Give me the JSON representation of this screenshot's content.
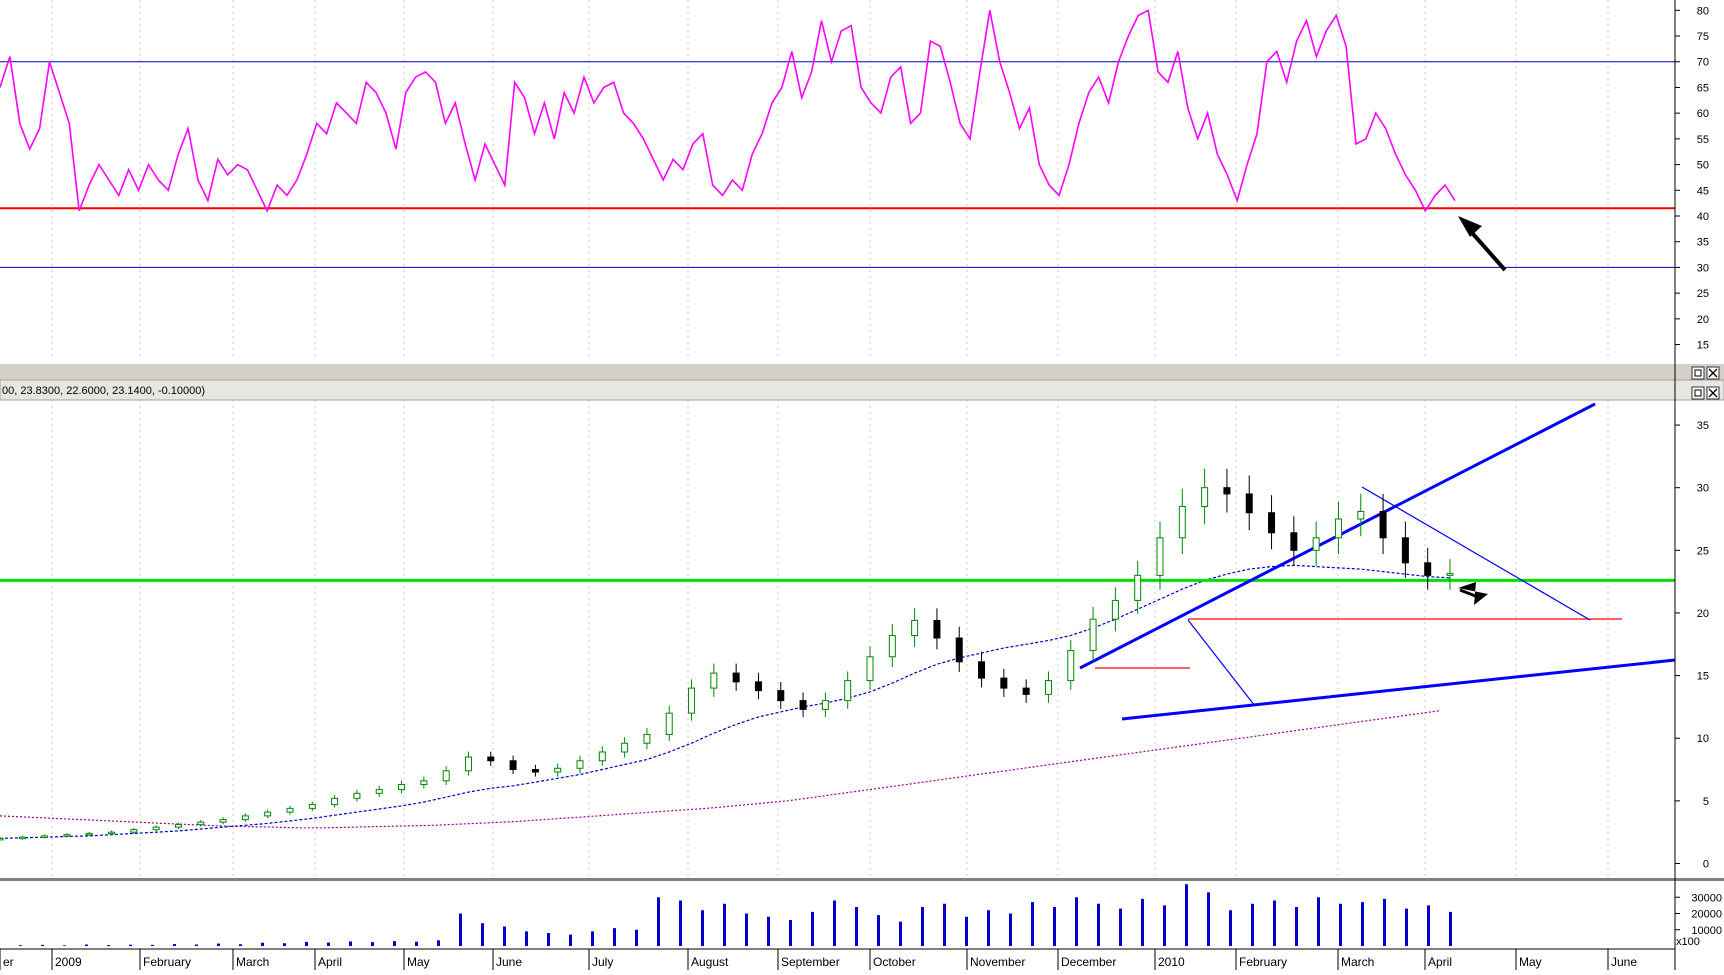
{
  "colors": {
    "rsi_line": "#ff00ff",
    "band": "#0000cc",
    "support": "#ff0000",
    "resistance": "#00dd00",
    "trend": "#0000ff",
    "ma_short": "#0000cc",
    "ma_long": "#990099",
    "bull": "#008800",
    "bear": "#000000",
    "volume": "#0000cc",
    "separator": "#d4d0c8"
  },
  "header": {
    "price_readout": "00, 23.8300, 22.6000, 23.1400, -0.10000)"
  },
  "window_controls": {
    "maximize": "□",
    "close": "✕"
  },
  "volume_multiplier": "x100",
  "chart_data": [
    {
      "panel": "rsi",
      "type": "line",
      "ylim": [
        12,
        82
      ],
      "yticks": [
        15,
        20,
        25,
        30,
        35,
        40,
        45,
        50,
        55,
        60,
        65,
        70,
        75,
        80
      ],
      "bands": [
        70,
        30
      ],
      "support_level": 41.5,
      "values": [
        65,
        71,
        58,
        53,
        57,
        70,
        64,
        58,
        41,
        46,
        50,
        47,
        44,
        49,
        45,
        50,
        47,
        45,
        52,
        57,
        47,
        43,
        51,
        48,
        50,
        49,
        45,
        41,
        46,
        44,
        47,
        52,
        58,
        56,
        62,
        60,
        58,
        66,
        64,
        60,
        53,
        64,
        67,
        68,
        66,
        58,
        62,
        54,
        47,
        54,
        50,
        46,
        66,
        63,
        56,
        62,
        55,
        64,
        60,
        67,
        62,
        65,
        66,
        60,
        58,
        55,
        51,
        47,
        51,
        49,
        54,
        56,
        46,
        44,
        47,
        45,
        52,
        56,
        62,
        65,
        72,
        63,
        68,
        78,
        70,
        76,
        77,
        65,
        62,
        60,
        67,
        69,
        58,
        60,
        74,
        73,
        66,
        58,
        55,
        68,
        80,
        70,
        64,
        57,
        61,
        50,
        46,
        44,
        50,
        58,
        64,
        67,
        62,
        70,
        75,
        79,
        80,
        68,
        66,
        72,
        61,
        55,
        60,
        52,
        48,
        43,
        50,
        56,
        70,
        72,
        66,
        74,
        78,
        71,
        76,
        79,
        73,
        54,
        55,
        60,
        57,
        52,
        48,
        45,
        41,
        44,
        46,
        43
      ]
    },
    {
      "panel": "price",
      "type": "candlestick",
      "ylim": [
        -1,
        37
      ],
      "yticks": [
        0,
        5,
        10,
        15,
        20,
        25,
        30,
        35
      ],
      "close": [
        2,
        2.1,
        2.2,
        2.3,
        2.4,
        2.5,
        2.7,
        2.9,
        3.1,
        3.3,
        3.5,
        3.8,
        4.1,
        4.4,
        4.7,
        5.2,
        5.6,
        5.9,
        6.3,
        6.6,
        7.4,
        8.5,
        8.2,
        7.5,
        7.3,
        7.6,
        8.2,
        8.9,
        9.6,
        10.3,
        12,
        14,
        15.2,
        14.5,
        13.8,
        13,
        12.3,
        13,
        14.6,
        16.5,
        18.2,
        19.4,
        18,
        16.1,
        14.8,
        14,
        13.5,
        14.6,
        17,
        19.5,
        21,
        23,
        26,
        28.5,
        30,
        29.5,
        28,
        26.4,
        25,
        26,
        27.5,
        28.1,
        26,
        24,
        23,
        23.14
      ],
      "ma_short": [
        2,
        2.05,
        2.1,
        2.15,
        2.2,
        2.3,
        2.4,
        2.5,
        2.6,
        2.75,
        2.9,
        3.05,
        3.2,
        3.4,
        3.6,
        3.85,
        4.1,
        4.35,
        4.6,
        4.9,
        5.3,
        5.7,
        6,
        6.2,
        6.5,
        6.8,
        7.1,
        7.5,
        7.9,
        8.3,
        8.9,
        9.6,
        10.4,
        11.1,
        11.7,
        12.1,
        12.5,
        12.8,
        13.2,
        13.7,
        14.4,
        15.2,
        15.9,
        16.4,
        16.8,
        17.2,
        17.5,
        17.8,
        18.2,
        18.8,
        19.5,
        20.3,
        21.1,
        21.9,
        22.6,
        23.1,
        23.5,
        23.7,
        23.8,
        23.7,
        23.6,
        23.5,
        23.3,
        23.1,
        22.9,
        22.8
      ],
      "ma_long": [
        3.8,
        3.7,
        3.6,
        3.5,
        3.4,
        3.3,
        3.2,
        3.1,
        3,
        2.95,
        2.9,
        2.85,
        2.85,
        2.9,
        2.95,
        3,
        3.05,
        3.15,
        3.25,
        3.35,
        3.5,
        3.65,
        3.8,
        3.95,
        4.1,
        4.25,
        4.4,
        4.6,
        4.8,
        5,
        5.3,
        5.6,
        5.9,
        6.2,
        6.5,
        6.8,
        7.1,
        7.4,
        7.7,
        8,
        8.3,
        8.6,
        8.9,
        9.2,
        9.5,
        9.8,
        10.1,
        10.4,
        10.7,
        11,
        11.3,
        11.6,
        11.9,
        12.2
      ],
      "resistance_level": 22.6,
      "support_levels": [
        19.8,
        15.8
      ],
      "trendlines": [
        "upper channel",
        "lower channel",
        "descending"
      ]
    },
    {
      "panel": "volume",
      "type": "bar",
      "yticks": [
        10000,
        20000,
        30000
      ],
      "values": [
        500,
        700,
        400,
        900,
        600,
        800,
        700,
        1200,
        900,
        1500,
        1100,
        2000,
        1700,
        2500,
        2100,
        2800,
        2400,
        3000,
        2600,
        3500,
        20000,
        14000,
        12000,
        9000,
        8000,
        7000,
        9000,
        11000,
        10000,
        30000,
        28000,
        22000,
        26000,
        20000,
        18000,
        16000,
        21000,
        28000,
        24000,
        19000,
        15000,
        24000,
        26000,
        18000,
        22000,
        20000,
        27000,
        24000,
        30000,
        26000,
        23000,
        29000,
        25000,
        38000,
        33000,
        22000,
        26000,
        28000,
        24000,
        30000,
        26000,
        27000,
        29000,
        23000,
        25000,
        21000
      ]
    }
  ],
  "x_axis": {
    "months": [
      "er",
      "2009",
      "February",
      "March",
      "April",
      "May",
      "June",
      "July",
      "August",
      "September",
      "October",
      "November",
      "December",
      "2010",
      "February",
      "March",
      "April",
      "May",
      "June"
    ]
  }
}
